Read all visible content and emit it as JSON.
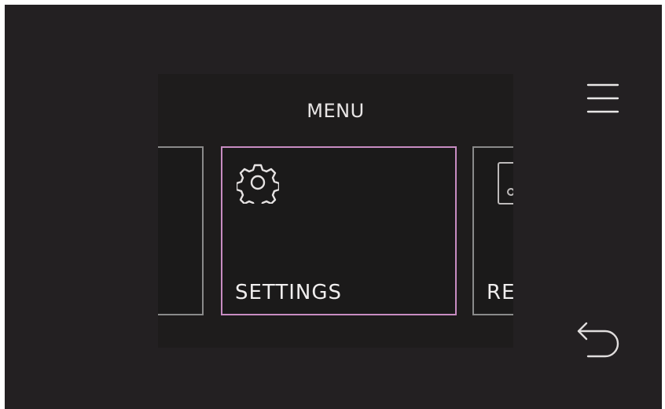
{
  "screen": {
    "title": "MENU"
  },
  "cards": [
    {
      "label": "",
      "icon": "blank"
    },
    {
      "label": "SETTINGS",
      "icon": "gear-icon",
      "selected": true
    },
    {
      "label": "RE",
      "icon": "device-icon"
    }
  ],
  "controls": {
    "menu_icon": "hamburger-icon",
    "back_icon": "back-arrow-icon"
  },
  "colors": {
    "background": "#232022",
    "panel": "#1e1c1c",
    "selected_border": "#c88cc2",
    "card_border": "#8a8a8a",
    "text": "#f0eeee"
  }
}
